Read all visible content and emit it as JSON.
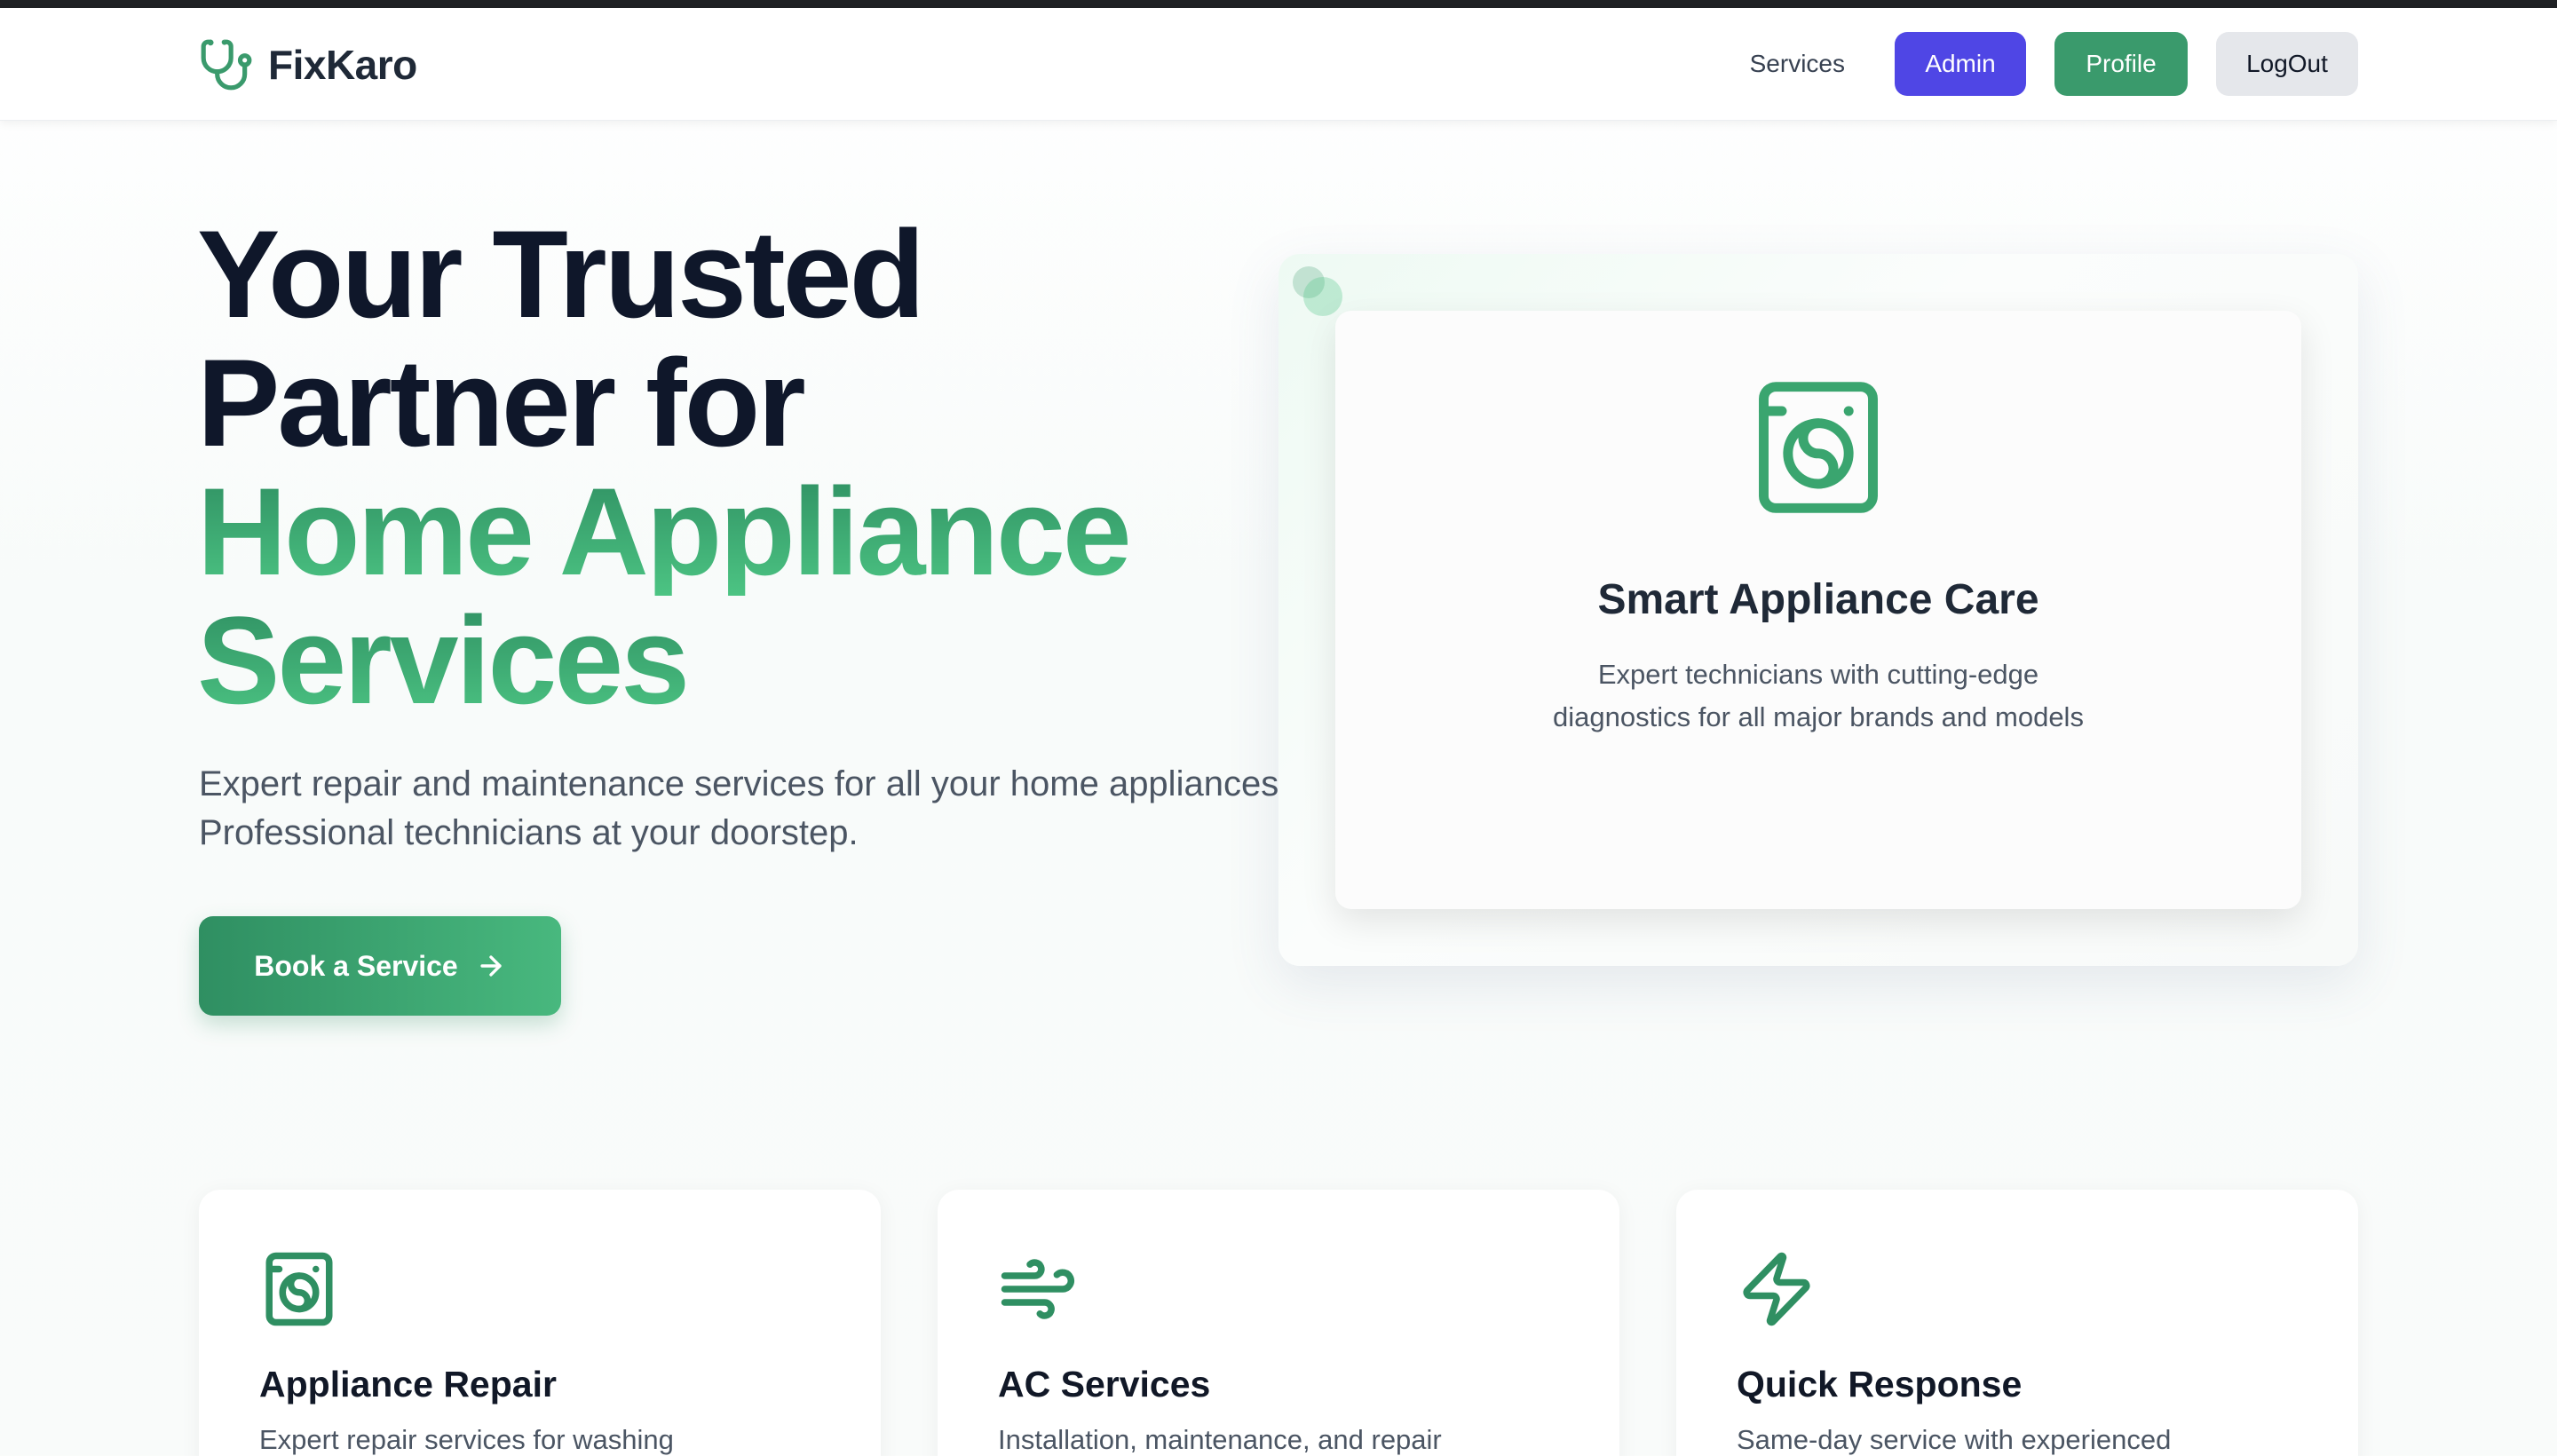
{
  "app": {
    "brand": "FixKaro",
    "brand_icon": "stethoscope-icon",
    "colors": {
      "primary_green": "#3a9a6c",
      "admin_indigo": "#4f46e5",
      "logout_gray": "#e5e7eb",
      "dark_text": "#0f172a"
    }
  },
  "nav": {
    "services_label": "Services",
    "admin_label": "Admin",
    "profile_label": "Profile",
    "logout_label": "LogOut"
  },
  "hero": {
    "title_line1": "Your Trusted",
    "title_line2": "Partner for",
    "title_line3": "Home Appliance",
    "title_line4": "Services",
    "subtitle_line1": "Expert repair and maintenance services for all your home appliances.",
    "subtitle_line2": "Professional technicians at your doorstep.",
    "cta_label": "Book a Service",
    "cta_icon": "arrow-right-icon"
  },
  "promo_card": {
    "icon": "washing-machine-icon",
    "title": "Smart Appliance Care",
    "desc_line1": "Expert technicians with cutting-edge",
    "desc_line2": "diagnostics for all major brands and models"
  },
  "features": [
    {
      "icon": "washing-machine-icon",
      "title": "Appliance Repair",
      "desc": "Expert repair services for washing"
    },
    {
      "icon": "wind-icon",
      "title": "AC Services",
      "desc": "Installation, maintenance, and repair"
    },
    {
      "icon": "lightning-icon",
      "title": "Quick Response",
      "desc": "Same-day service with experienced"
    }
  ]
}
